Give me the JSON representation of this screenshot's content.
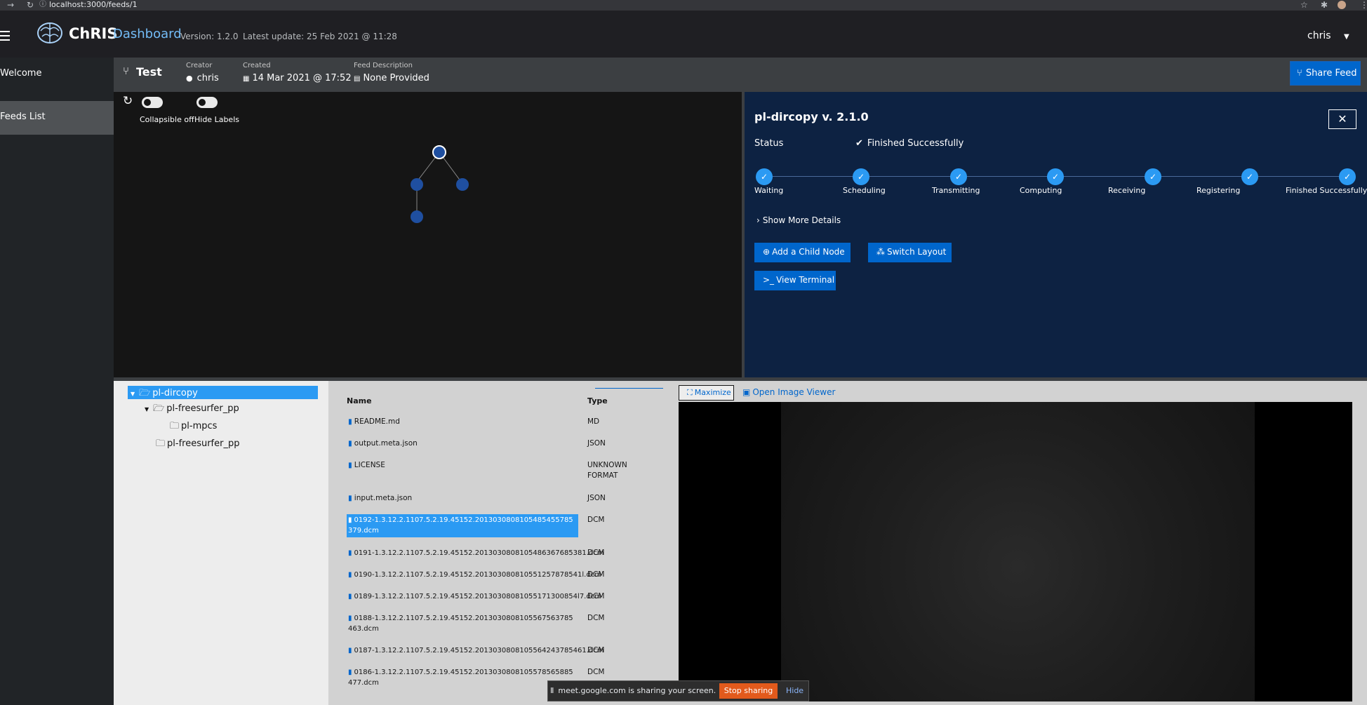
{
  "browser": {
    "url": "localhost:3000/feeds/1"
  },
  "masthead": {
    "brand_name": "ChRIS",
    "brand_sub": "Dashboard",
    "version": "Version: 1.2.0",
    "last_update": "Latest update: 25 Feb 2021 @ 11:28",
    "user": "chris"
  },
  "sidebar": {
    "items": [
      {
        "label": "Welcome"
      },
      {
        "label": "Feeds List"
      }
    ]
  },
  "feed": {
    "title": "Test",
    "creator_label": "Creator",
    "creator": "chris",
    "created_label": "Created",
    "created": "14 Mar 2021 @ 17:52",
    "desc_label": "Feed Description",
    "desc": "None Provided",
    "share_label": "Share Feed"
  },
  "graph": {
    "toggle_collapsible": "Collapsible off",
    "toggle_labels": "Hide Labels"
  },
  "node": {
    "title": "pl-dircopy v. 2.1.0",
    "status_label": "Status",
    "status_value": "Finished Successfully",
    "steps": [
      "Waiting",
      "Scheduling",
      "Transmitting",
      "Computing",
      "Receiving",
      "Registering",
      "Finished Successfully"
    ],
    "show_more": "Show More Details",
    "btn_add_child": "Add a Child Node",
    "btn_switch_layout": "Switch Layout",
    "btn_terminal": "View Terminal"
  },
  "tree": {
    "items": [
      "pl-dircopy",
      "pl-freesurfer_pp",
      "pl-mpcs",
      "pl-freesurfer_pp"
    ]
  },
  "files": {
    "col_name": "Name",
    "col_type": "Type",
    "rows": [
      {
        "name": "README.md",
        "type": "MD"
      },
      {
        "name": "output.meta.json",
        "type": "JSON"
      },
      {
        "name": "LICENSE",
        "type": "UNKNOWN FORMAT"
      },
      {
        "name": "input.meta.json",
        "type": "JSON"
      },
      {
        "name": "0192-1.3.12.2.1107.5.2.19.45152.2013030808105485455785379.dcm",
        "type": "DCM"
      },
      {
        "name": "0191-1.3.12.2.1107.5.2.19.45152.2013030808105486367685381.dcm",
        "type": "DCM"
      },
      {
        "name": "0190-1.3.12.2.1107.5.2.19.45152.201303080810551257878541l.dcm",
        "type": "DCM"
      },
      {
        "name": "0189-1.3.12.2.1107.5.2.19.45152.20130308081055171300854l7.dcm",
        "type": "DCM"
      },
      {
        "name": "0188-1.3.12.2.1107.5.2.19.45152.2013030808105567563785463.dcm",
        "type": "DCM"
      },
      {
        "name": "0187-1.3.12.2.1107.5.2.19.45152.2013030808105564243785461.dcm",
        "type": "DCM"
      },
      {
        "name": "0186-1.3.12.2.1107.5.2.19.45152.2013030808105578565885477.dcm",
        "type": "DCM"
      }
    ]
  },
  "viewer": {
    "maximize": "Maximize",
    "open_viewer": "Open Image Viewer"
  },
  "sharing": {
    "text": "meet.google.com is sharing your screen.",
    "stop": "Stop sharing",
    "hide": "Hide"
  }
}
